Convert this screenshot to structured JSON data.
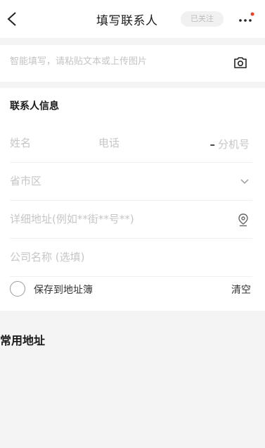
{
  "header": {
    "title": "填写联系人",
    "follow_badge": "已关注"
  },
  "smart_fill": {
    "placeholder": "智能填写，请粘贴文本或上传图片"
  },
  "contact": {
    "section_title": "联系人信息",
    "name_placeholder": "姓名",
    "phone_placeholder": "电话",
    "ext_dash": "–",
    "ext_label": "分机号",
    "region_placeholder": "省市区",
    "address_placeholder": "详细地址(例如**街**号**)",
    "company_placeholder": "公司名称 (选填)",
    "save_label": "保存到地址簿",
    "clear_label": "清空"
  },
  "common": {
    "title": "常用地址"
  },
  "colors": {
    "notification_dot": "#e8412c",
    "background": "#f4f4f5"
  }
}
